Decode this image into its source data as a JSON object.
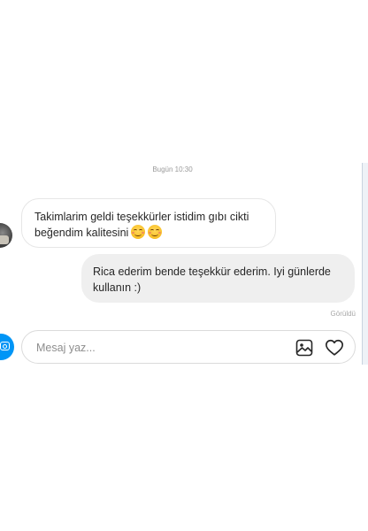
{
  "conversation": {
    "timestamp": "Bugün 10:30",
    "messages": [
      {
        "direction": "incoming",
        "line1": "Takimlarim geldi teşekkürler istidim gıbı cikti",
        "line2": "beğendim kalitesini",
        "emojis": [
          "smiling-face-icon",
          "smiling-face-icon"
        ]
      },
      {
        "direction": "outgoing",
        "line1": "Rica ederim bende teşekkür ederim. Iyi günlerde",
        "line2": "kullanın :)"
      }
    ],
    "seen_label": "Görüldü"
  },
  "composer": {
    "placeholder": "Mesaj yaz...",
    "value": ""
  },
  "colors": {
    "accent": "#0095f6",
    "outgoing_bubble": "#efefef",
    "incoming_border": "#e6e6e6",
    "text": "#262626",
    "muted": "#9a9a9a"
  }
}
